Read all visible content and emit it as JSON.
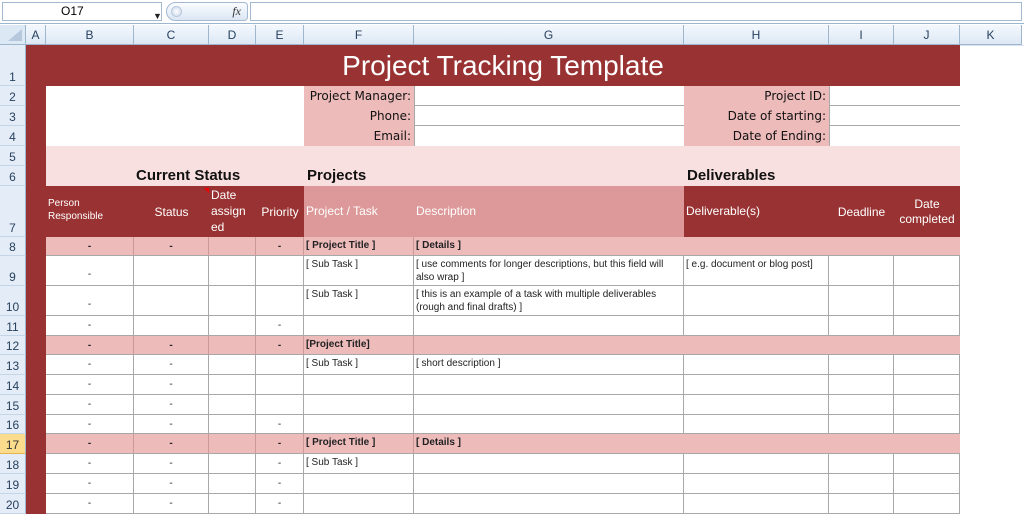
{
  "formula_bar": {
    "name_box": "O17",
    "fx_label": "fx",
    "formula": ""
  },
  "columns": [
    "A",
    "B",
    "C",
    "D",
    "E",
    "F",
    "G",
    "H",
    "I",
    "J",
    "K"
  ],
  "rows": [
    "1",
    "2",
    "3",
    "4",
    "5",
    "6",
    "7",
    "8",
    "9",
    "10",
    "11",
    "12",
    "13",
    "14",
    "15",
    "16",
    "17",
    "18",
    "19",
    "20"
  ],
  "selected_row": "17",
  "sheet": {
    "title": "Project Tracking Template",
    "info_left": {
      "project_manager_label": "Project Manager:",
      "phone_label": "Phone:",
      "email_label": "Email:",
      "project_manager_value": "",
      "phone_value": "",
      "email_value": ""
    },
    "info_right": {
      "project_id_label": "Project ID:",
      "date_starting_label": "Date of starting:",
      "date_ending_label": "Date of Ending:",
      "project_id_value": "",
      "date_starting_value": "",
      "date_ending_value": ""
    },
    "sections": {
      "current_status": "Current Status",
      "projects": "Projects",
      "deliverables": "Deliverables"
    },
    "headers": {
      "person": "Person Responsible",
      "status": "Status",
      "date_assigned": "Date assign ed",
      "priority": "Priority",
      "project_task": "Project / Task",
      "description": "Description",
      "deliverables": "Deliverable(s)",
      "deadline": "Deadline",
      "date_completed": "Date completed"
    },
    "data_rows": [
      {
        "row": "8",
        "type": "project",
        "person": "-",
        "status": "-",
        "date": "",
        "priority": "-",
        "task": "[ Project Title ]",
        "desc": "[ Details ]",
        "deliv": "",
        "deadline": "",
        "completed": ""
      },
      {
        "row": "9",
        "type": "task",
        "person": "-",
        "status": "",
        "date": "",
        "priority": "",
        "task": "[ Sub Task ]",
        "desc": "[ use comments for longer descriptions, but this field will also wrap ]",
        "deliv": "[ e.g. document or blog post]",
        "deadline": "",
        "completed": ""
      },
      {
        "row": "10",
        "type": "task",
        "person": "-",
        "status": "",
        "date": "",
        "priority": "",
        "task": "[ Sub Task ]",
        "desc": "[ this is an example of a task with multiple deliverables (rough and final drafts) ]",
        "deliv": "",
        "deadline": "",
        "completed": ""
      },
      {
        "row": "11",
        "type": "task",
        "person": "-",
        "status": "",
        "date": "",
        "priority": "-",
        "task": "",
        "desc": "",
        "deliv": "",
        "deadline": "",
        "completed": ""
      },
      {
        "row": "12",
        "type": "project",
        "person": "-",
        "status": "-",
        "date": "",
        "priority": "-",
        "task": "[Project Title]",
        "desc": "",
        "deliv": "",
        "deadline": "",
        "completed": ""
      },
      {
        "row": "13",
        "type": "task",
        "person": "-",
        "status": "-",
        "date": "",
        "priority": "",
        "task": "[ Sub Task ]",
        "desc": "[ short description ]",
        "deliv": "",
        "deadline": "",
        "completed": ""
      },
      {
        "row": "14",
        "type": "task",
        "person": "-",
        "status": "-",
        "date": "",
        "priority": "",
        "task": "",
        "desc": "",
        "deliv": "",
        "deadline": "",
        "completed": ""
      },
      {
        "row": "15",
        "type": "task",
        "person": "-",
        "status": "-",
        "date": "",
        "priority": "",
        "task": "",
        "desc": "",
        "deliv": "",
        "deadline": "",
        "completed": ""
      },
      {
        "row": "16",
        "type": "task",
        "person": "-",
        "status": "-",
        "date": "",
        "priority": "-",
        "task": "",
        "desc": "",
        "deliv": "",
        "deadline": "",
        "completed": ""
      },
      {
        "row": "17",
        "type": "project",
        "person": "-",
        "status": "-",
        "date": "",
        "priority": "-",
        "task": "[ Project Title ]",
        "desc": "[ Details ]",
        "deliv": "",
        "deadline": "",
        "completed": ""
      },
      {
        "row": "18",
        "type": "task",
        "person": "-",
        "status": "-",
        "date": "",
        "priority": "-",
        "task": "[ Sub Task ]",
        "desc": "",
        "deliv": "",
        "deadline": "",
        "completed": ""
      },
      {
        "row": "19",
        "type": "task",
        "person": "-",
        "status": "-",
        "date": "",
        "priority": "-",
        "task": "",
        "desc": "",
        "deliv": "",
        "deadline": "",
        "completed": ""
      },
      {
        "row": "20",
        "type": "task",
        "person": "-",
        "status": "-",
        "date": "",
        "priority": "-",
        "task": "",
        "desc": "",
        "deliv": "",
        "deadline": "",
        "completed": ""
      }
    ]
  },
  "colors": {
    "dark_red": "#993333",
    "project_row_pink": "#eebbbb",
    "light_pink": "#f9e0e0",
    "header_mid_pink": "#dd9999"
  }
}
